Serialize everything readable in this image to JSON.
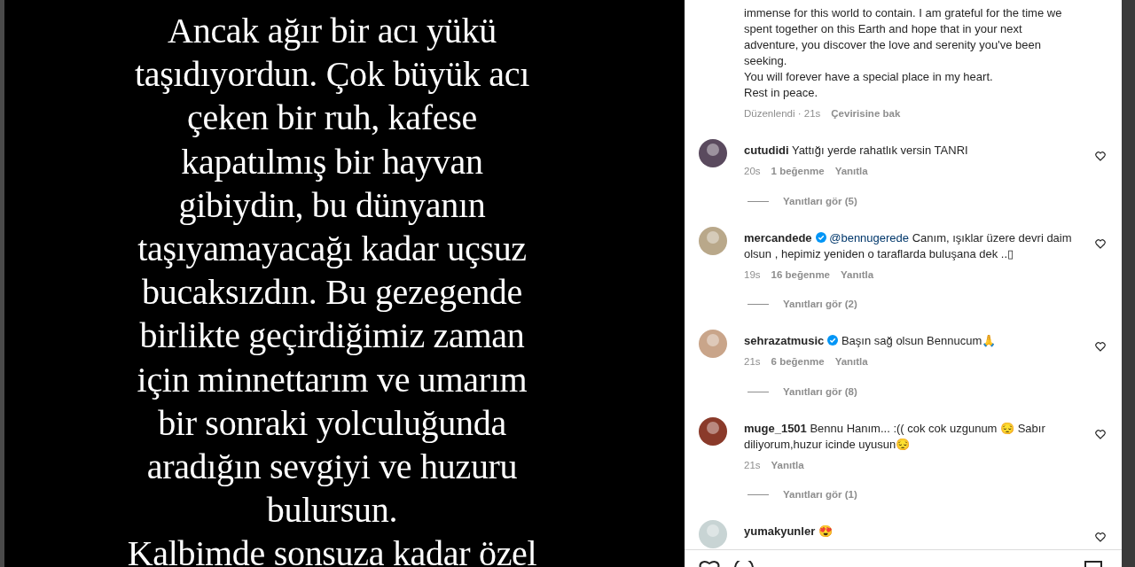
{
  "post_image": {
    "lines": [
      "Ancak ağır bir acı yükü",
      "taşıdıyordun. Çok büyük acı",
      "çeken bir ruh, kafese",
      "kapatılmış bir hayvan",
      "gibiydin, bu dünyanın",
      "taşıyamayacağı kadar uçsuz",
      "bucaksızdın. Bu gezegende",
      "birlikte geçirdiğimiz zaman",
      "için minnettarım ve umarım",
      "bir sonraki yolculuğunda",
      "aradığın sevgiyi ve huzuru",
      "bulursun.",
      "Kalbimde sonsuza kadar özel"
    ]
  },
  "caption": {
    "lines": [
      "immense for this world to contain. I am grateful for the time we",
      "spent together on this Earth and hope that in your next",
      "adventure, you discover the love and serenity you've been",
      "seeking.",
      "You will forever have a special place in my heart.",
      "Rest in peace."
    ],
    "edited": "Düzenlendi · 21s",
    "translate": "Çevirisine bak"
  },
  "comments": [
    {
      "username": "cutudidi",
      "verified": false,
      "text": "Yattığı yerde rahatlık versin TANRI",
      "time": "20s",
      "likes": "1 beğenme",
      "reply": "Yanıtla",
      "replies": "Yanıtları gör (5)"
    },
    {
      "username": "mercandede",
      "verified": true,
      "mention": "@bennugerede",
      "text": "Canım, ışıklar üzere devri daim olsun , hepimiz yeniden o taraflarda buluşana dek ..▯",
      "time": "19s",
      "likes": "16 beğenme",
      "reply": "Yanıtla",
      "replies": "Yanıtları gör (2)"
    },
    {
      "username": "sehrazatmusic",
      "verified": true,
      "text": "Başın sağ olsun Bennucum🙏",
      "time": "21s",
      "likes": "6 beğenme",
      "reply": "Yanıtla",
      "replies": "Yanıtları gör (8)"
    },
    {
      "username": "muge_1501",
      "verified": false,
      "text": "Bennu Hanım... :(( cok cok uzgunum 😔 Sabır diliyorum,huzur icinde uyusun😔",
      "time": "21s",
      "reply": "Yanıtla",
      "replies": "Yanıtları gör (1)"
    },
    {
      "username": "yumakyunler",
      "verified": false,
      "text": "😍"
    }
  ]
}
